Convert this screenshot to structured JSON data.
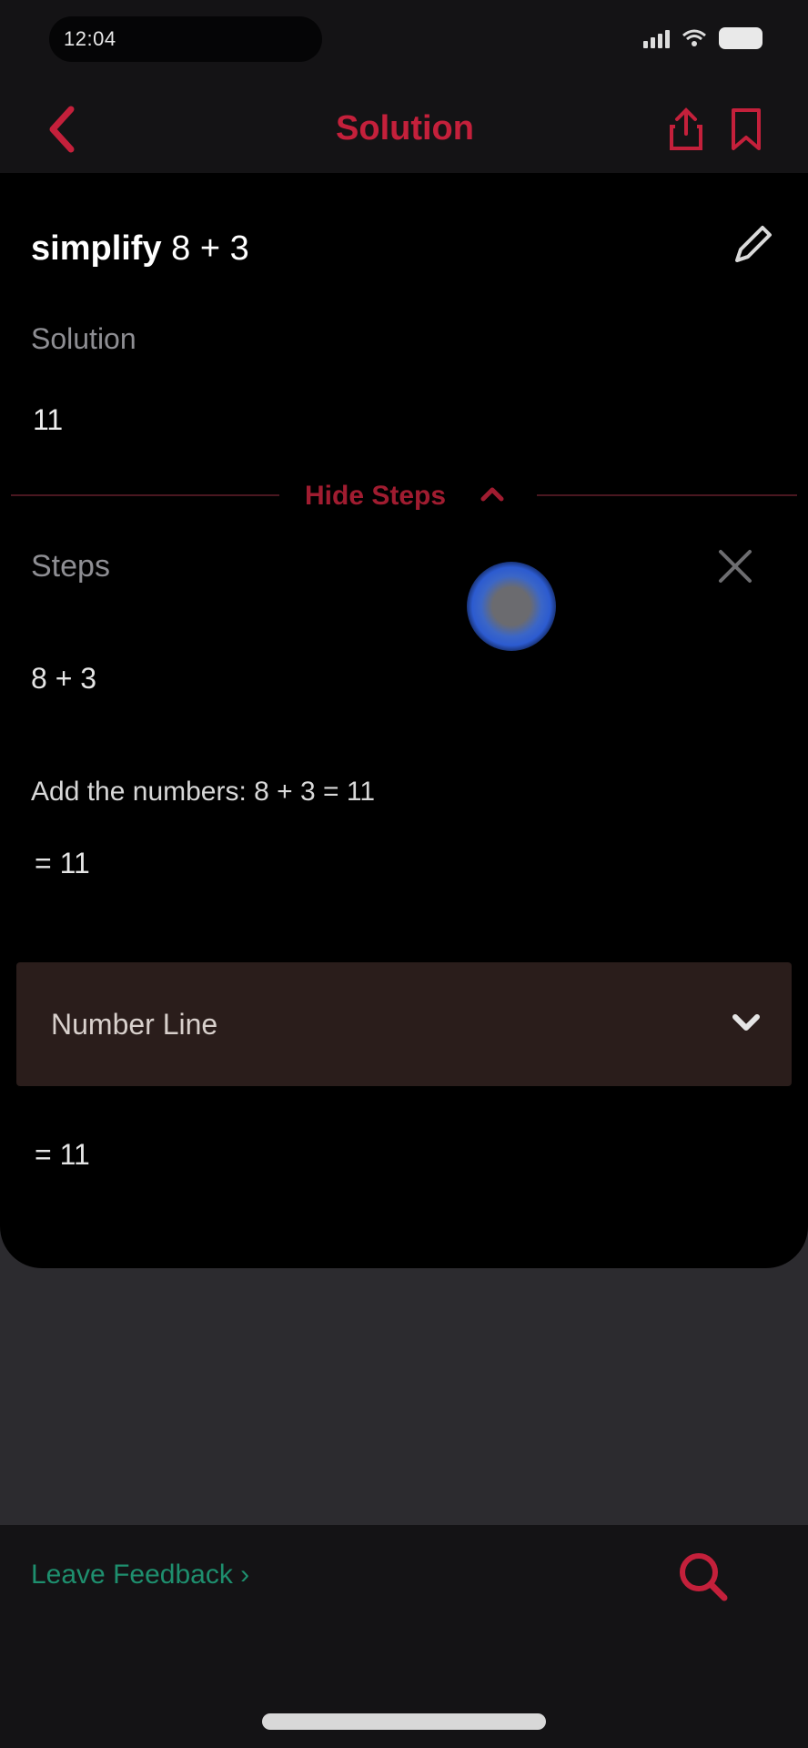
{
  "status_bar": {
    "time": "12:04",
    "signal": "signal-icon",
    "wifi": "wifi-icon",
    "battery": "battery-icon"
  },
  "nav": {
    "title": "Solution",
    "back_icon": "chevron-left-icon",
    "share_icon": "share-icon",
    "bookmark_icon": "bookmark-icon",
    "accent_color": "#c4203b"
  },
  "problem": {
    "verb": "simplify",
    "expression": "8 + 3",
    "edit_icon": "pencil-icon"
  },
  "solution": {
    "label": "Solution",
    "value": "11"
  },
  "steps_toggle": {
    "label": "Hide Steps",
    "icon": "chevron-up-icon"
  },
  "steps": {
    "label": "Steps",
    "close_icon": "close-icon",
    "items": [
      {
        "expression": "8 + 3"
      },
      {
        "description": "Add the numbers: 8 + 3 = 11",
        "result": "= 11"
      }
    ]
  },
  "number_line": {
    "label": "Number Line",
    "icon": "chevron-down-icon",
    "result": "= 11"
  },
  "footer": {
    "feedback_link": "Leave Feedback ›",
    "feedback_color": "#1e8f6e",
    "search_icon": "search-icon"
  }
}
